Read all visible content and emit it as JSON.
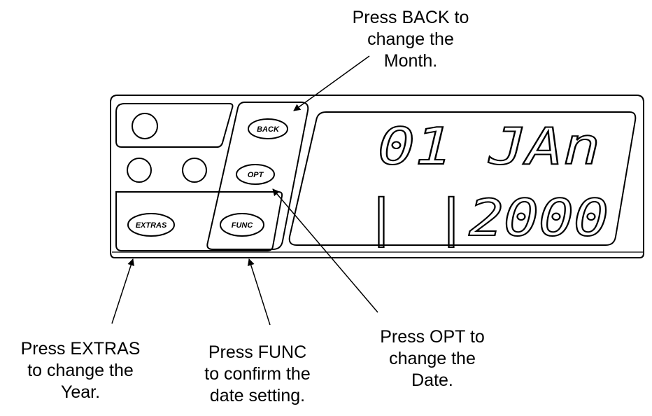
{
  "panel": {
    "buttons": {
      "back": "BACK",
      "opt": "OPT",
      "extras": "EXTRAS",
      "func": "FUNC"
    },
    "display": {
      "top_line": "01 JAn",
      "bottom_line": "|  |2000"
    }
  },
  "callouts": {
    "back": [
      "Press BACK to",
      "change the",
      "Month."
    ],
    "opt": [
      "Press OPT to",
      "change the",
      "Date."
    ],
    "extras": [
      "Press EXTRAS",
      "to change the",
      "Year."
    ],
    "func": [
      "Press FUNC",
      "to confirm the",
      "date setting."
    ]
  },
  "colors": {
    "ink": "#000000",
    "background": "#ffffff"
  }
}
